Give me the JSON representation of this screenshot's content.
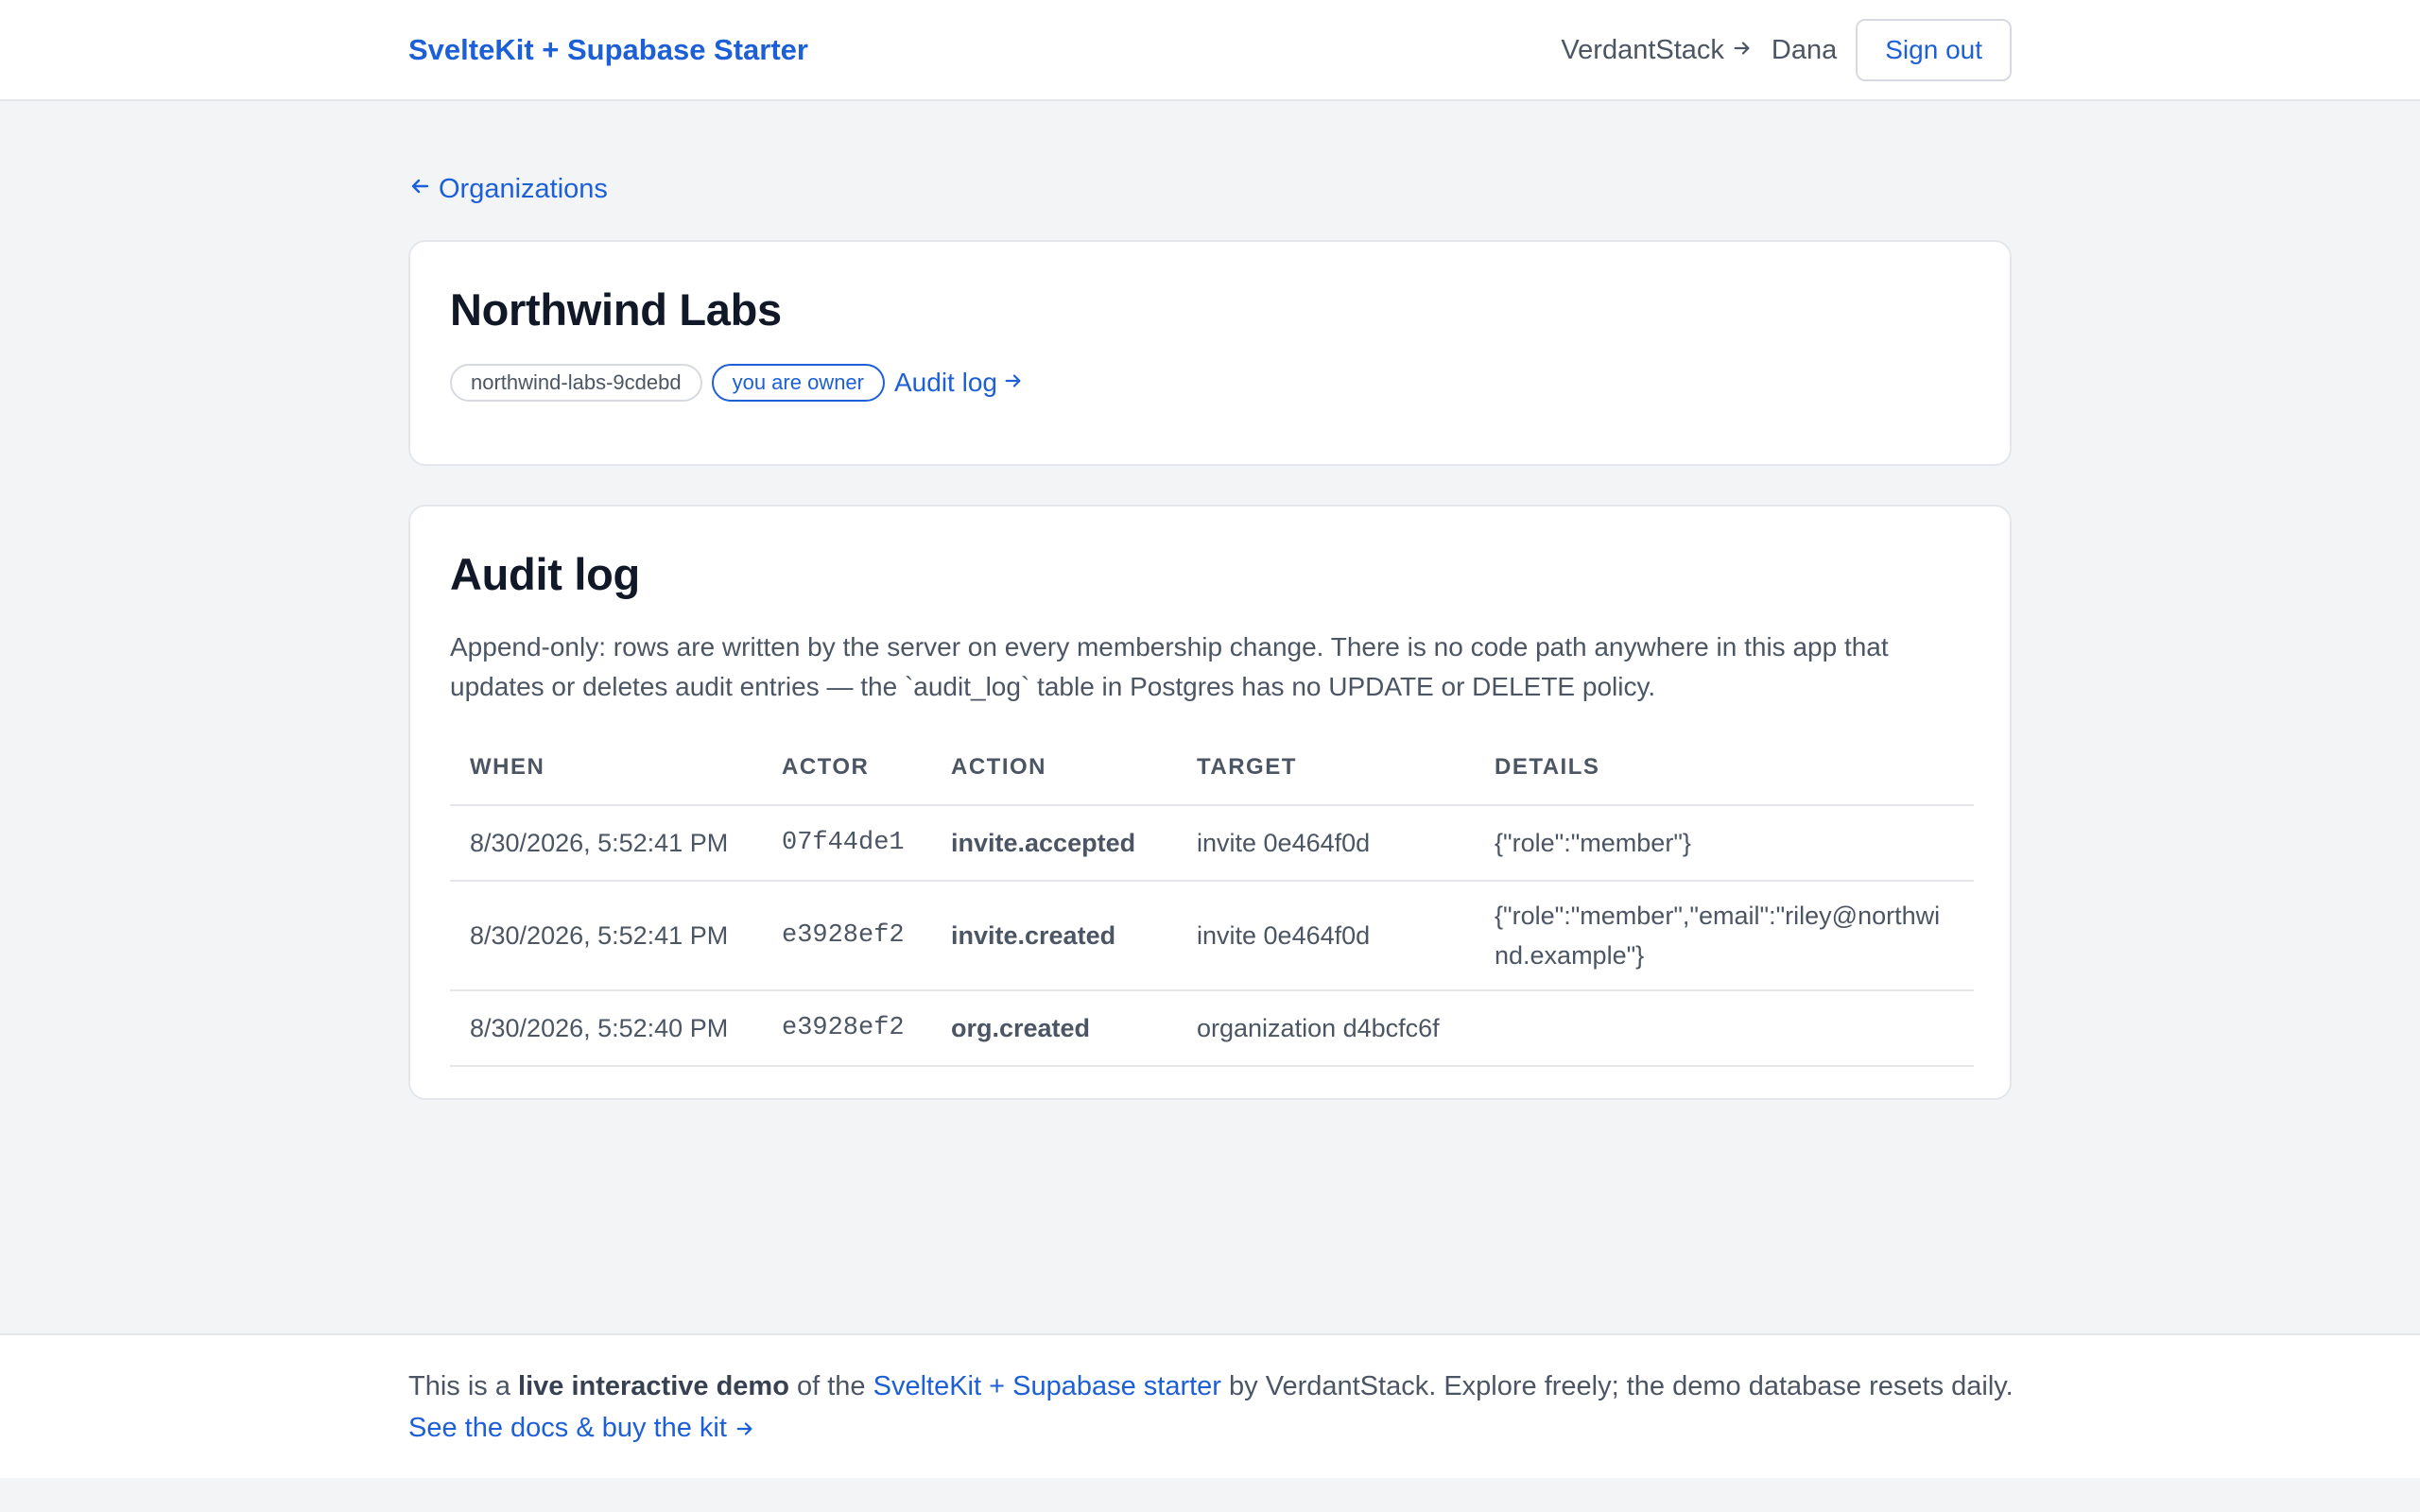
{
  "header": {
    "brand": "SvelteKit + Supabase Starter",
    "vendor_link": "VerdantStack",
    "user": "Dana",
    "sign_out": "Sign out"
  },
  "nav": {
    "back_label": "Organizations"
  },
  "organization": {
    "name": "Northwind Labs",
    "slug": "northwind-labs-9cdebd",
    "role_badge": "you are owner",
    "audit_link": "Audit log"
  },
  "audit": {
    "title": "Audit log",
    "description": "Append-only: rows are written by the server on every membership change. There is no code path anywhere in this app that updates or deletes audit entries — the `audit_log` table in Postgres has no UPDATE or DELETE policy.",
    "columns": [
      "WHEN",
      "ACTOR",
      "ACTION",
      "TARGET",
      "DETAILS"
    ],
    "rows": [
      {
        "when": "8/30/2026, 5:52:41 PM",
        "actor": "07f44de1",
        "action": "invite.accepted",
        "target": "invite 0e464f0d",
        "details": "{\"role\":\"member\"}"
      },
      {
        "when": "8/30/2026, 5:52:41 PM",
        "actor": "e3928ef2",
        "action": "invite.created",
        "target": "invite 0e464f0d",
        "details": "{\"role\":\"member\",\"email\":\"riley@northwind.example\"}"
      },
      {
        "when": "8/30/2026, 5:52:40 PM",
        "actor": "e3928ef2",
        "action": "org.created",
        "target": "organization d4bcfc6f",
        "details": ""
      }
    ]
  },
  "footer": {
    "prefix": "This is a ",
    "emphasis": "live interactive demo",
    "middle": " of the ",
    "starter_link": "SvelteKit + Supabase starter",
    "suffix": " by VerdantStack. Explore freely; the demo database resets daily.",
    "cta": "See the docs & buy the kit"
  },
  "icons": {
    "back": "arrow-left-icon",
    "forward": "arrow-right-icon"
  },
  "colors": {
    "accent": "#1d5fd6",
    "background": "#f3f4f6",
    "card": "#ffffff",
    "text": "#111827",
    "muted": "#4b5563"
  }
}
